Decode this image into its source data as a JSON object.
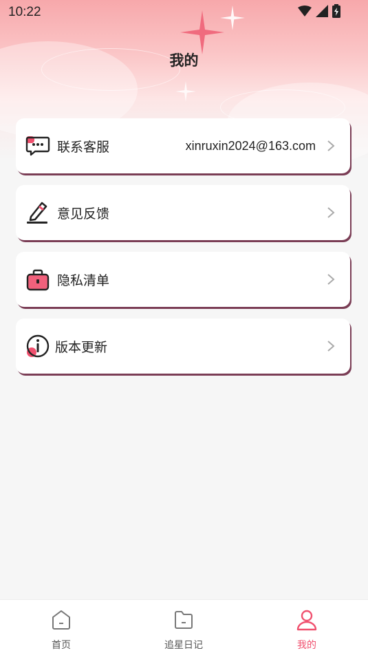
{
  "status_bar": {
    "time": "10:22"
  },
  "header": {
    "title": "我的"
  },
  "menu": {
    "items": [
      {
        "label": "联系客服",
        "value": "xinruxin2024@163.com",
        "icon": "chat-icon"
      },
      {
        "label": "意见反馈",
        "value": "",
        "icon": "edit-icon"
      },
      {
        "label": "隐私清单",
        "value": "",
        "icon": "briefcase-icon"
      },
      {
        "label": "版本更新",
        "value": "",
        "icon": "info-icon"
      }
    ]
  },
  "tabbar": {
    "tabs": [
      {
        "label": "首页",
        "icon": "home-icon",
        "active": false
      },
      {
        "label": "追星日记",
        "icon": "folder-icon",
        "active": false
      },
      {
        "label": "我的",
        "icon": "user-icon",
        "active": true
      }
    ]
  },
  "colors": {
    "accent": "#f0506e",
    "card_shadow": "#7a3d55",
    "background": "#f6f6f6"
  }
}
